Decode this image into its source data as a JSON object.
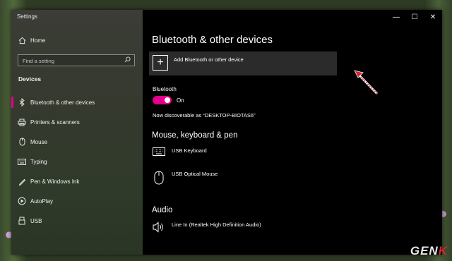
{
  "window": {
    "title": "Settings",
    "controls": {
      "minimize": "—",
      "maximize": "☐",
      "close": "✕"
    }
  },
  "sidebar": {
    "home_label": "Home",
    "search_placeholder": "Find a setting",
    "section_label": "Devices",
    "items": [
      {
        "label": "Bluetooth & other devices",
        "icon": "bluetooth-icon",
        "active": true
      },
      {
        "label": "Printers & scanners",
        "icon": "printer-icon",
        "active": false
      },
      {
        "label": "Mouse",
        "icon": "mouse-icon",
        "active": false
      },
      {
        "label": "Typing",
        "icon": "keyboard-icon",
        "active": false
      },
      {
        "label": "Pen & Windows Ink",
        "icon": "pen-icon",
        "active": false
      },
      {
        "label": "AutoPlay",
        "icon": "autoplay-icon",
        "active": false
      },
      {
        "label": "USB",
        "icon": "usb-icon",
        "active": false
      }
    ]
  },
  "main": {
    "title": "Bluetooth & other devices",
    "add_device_label": "Add Bluetooth or other device",
    "bluetooth": {
      "label": "Bluetooth",
      "toggle_state": "On",
      "discoverable_text": "Now discoverable as “DESKTOP-BIOTAS6”"
    },
    "sections": {
      "input": {
        "heading": "Mouse, keyboard & pen",
        "devices": [
          {
            "name": "USB Keyboard",
            "icon": "keyboard-icon"
          },
          {
            "name": "USB Optical Mouse",
            "icon": "mouse-icon"
          }
        ]
      },
      "audio": {
        "heading": "Audio",
        "devices": [
          {
            "name": "Line In (Realtek High Definition Audio)",
            "icon": "speaker-icon"
          }
        ]
      }
    }
  },
  "watermark": {
    "part1": "GEN",
    "part2": "K"
  },
  "colors": {
    "accent": "#e3008c",
    "window_bg": "#000000",
    "button_bg": "#2b2b2b"
  }
}
